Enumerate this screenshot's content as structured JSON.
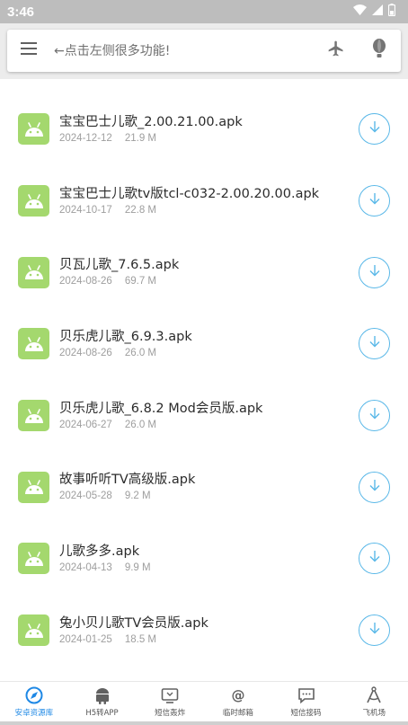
{
  "status_bar": {
    "time": "3:46",
    "icons": [
      "wifi-icon",
      "signal-icon",
      "battery-icon"
    ]
  },
  "search": {
    "placeholder": "←点击左侧很多功能!",
    "icons": [
      "menu-icon",
      "airplane-icon",
      "balloon-icon"
    ]
  },
  "colors": {
    "accent": "#1e88e5",
    "android_green": "#a4d86e",
    "download_blue": "#5ab8e8"
  },
  "files": [
    {
      "name": "宝宝巴士儿歌_2.00.21.00.apk",
      "date": "2024-12-12",
      "size": "21.9 M"
    },
    {
      "name": "宝宝巴士儿歌tv版tcl-c032-2.00.20.00.apk",
      "date": "2024-10-17",
      "size": "22.8 M"
    },
    {
      "name": "贝瓦儿歌_7.6.5.apk",
      "date": "2024-08-26",
      "size": "69.7 M"
    },
    {
      "name": "贝乐虎儿歌_6.9.3.apk",
      "date": "2024-08-26",
      "size": "26.0 M"
    },
    {
      "name": "贝乐虎儿歌_6.8.2 Mod会员版.apk",
      "date": "2024-06-27",
      "size": "26.0 M"
    },
    {
      "name": "故事听听TV高级版.apk",
      "date": "2024-05-28",
      "size": "9.2 M"
    },
    {
      "name": "儿歌多多.apk",
      "date": "2024-04-13",
      "size": "9.9 M"
    },
    {
      "name": "兔小贝儿歌TV会员版.apk",
      "date": "2024-01-25",
      "size": "18.5 M"
    }
  ],
  "nav": [
    {
      "label": "安卓资源库",
      "icon": "compass-icon",
      "active": true
    },
    {
      "label": "H5转APP",
      "icon": "android-icon",
      "active": false
    },
    {
      "label": "短信轰炸",
      "icon": "tv-icon",
      "active": false
    },
    {
      "label": "临时邮箱",
      "icon": "at-icon",
      "active": false
    },
    {
      "label": "短信接码",
      "icon": "chat-icon",
      "active": false
    },
    {
      "label": "飞机场",
      "icon": "compass-tool-icon",
      "active": false
    }
  ]
}
